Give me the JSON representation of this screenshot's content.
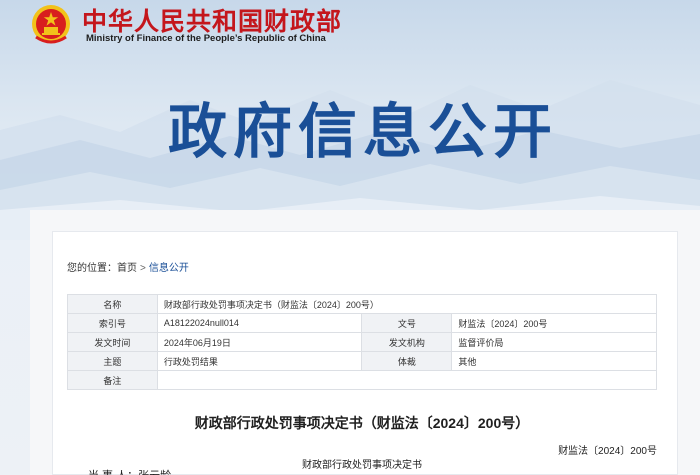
{
  "header": {
    "site_name_cn": "中华人民共和国财政部",
    "site_name_en": "Ministry of Finance of the People’s Republic of China",
    "banner_title": "政府信息公开"
  },
  "breadcrumb": {
    "prefix": "您的位置：",
    "home": "首页",
    "separator": ">",
    "current": "信息公开"
  },
  "meta": {
    "name_label": "名称",
    "name_value": "财政部行政处罚事项决定书（财监法〔2024〕200号）",
    "index_label": "索引号",
    "index_value": "A18122024null014",
    "doc_no_label": "文号",
    "doc_no_value": "财监法〔2024〕200号",
    "date_label": "发文时间",
    "date_value": "2024年06月19日",
    "org_label": "发文机构",
    "org_value": "监督评价局",
    "topic_label": "主题",
    "topic_value": "行政处罚结果",
    "genre_label": "体裁",
    "genre_value": "其他",
    "remark_label": "备注",
    "remark_value": ""
  },
  "document": {
    "title": "财政部行政处罚事项决定书（财监法〔2024〕200号）",
    "number": "财监法〔2024〕200号",
    "subtitle": "财政部行政处罚事项决定书",
    "party_line": "当 事 人：张云龄"
  },
  "colors": {
    "brand_red": "#c4161c",
    "banner_blue": "#1a4f97",
    "emblem_gold": "#f2c21a"
  }
}
